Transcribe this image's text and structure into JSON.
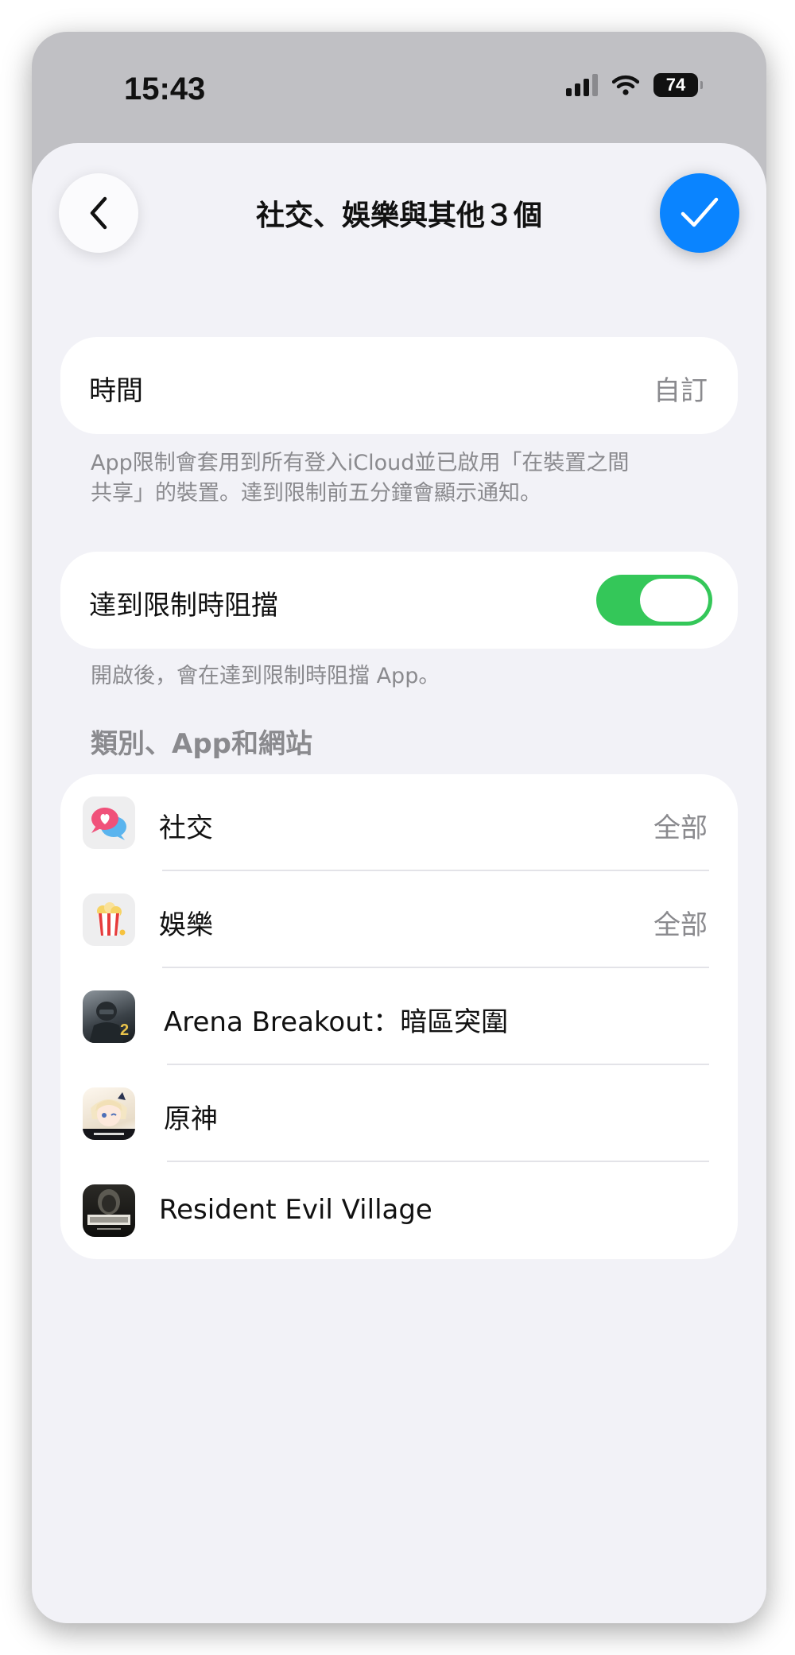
{
  "status_bar": {
    "time": "15:43",
    "battery": "74"
  },
  "nav": {
    "title": "社交、娛樂與其他３個",
    "back_icon": "chevron-left-icon",
    "done_icon": "checkmark-icon"
  },
  "time_row": {
    "label": "時間",
    "value": "自訂"
  },
  "time_footnote": {
    "line1": "App限制會套用到所有登入iCloud並已啟用「在裝置之間",
    "line2": "共享」的裝置。達到限制前五分鐘會顯示通知。"
  },
  "block_row": {
    "label": "達到限制時阻擋",
    "toggle_on": true
  },
  "block_footnote": "開啟後，會在達到限制時阻擋 App。",
  "section": {
    "header": "類別、App和網站",
    "items": [
      {
        "label": "社交",
        "value": "全部",
        "icon": "social-chat-icon"
      },
      {
        "label": "娛樂",
        "value": "全部",
        "icon": "popcorn-icon"
      },
      {
        "label": "Arena Breakout：暗區突圍",
        "icon": "arena-breakout-app-icon"
      },
      {
        "label": "原神",
        "icon": "genshin-app-icon"
      },
      {
        "label": "Resident Evil Village",
        "icon": "resident-evil-village-app-icon"
      }
    ]
  },
  "colors": {
    "accent": "#0a84ff",
    "toggle_on": "#34c759",
    "background": "#f2f2f7",
    "secondary_text": "#8a8a8e"
  }
}
